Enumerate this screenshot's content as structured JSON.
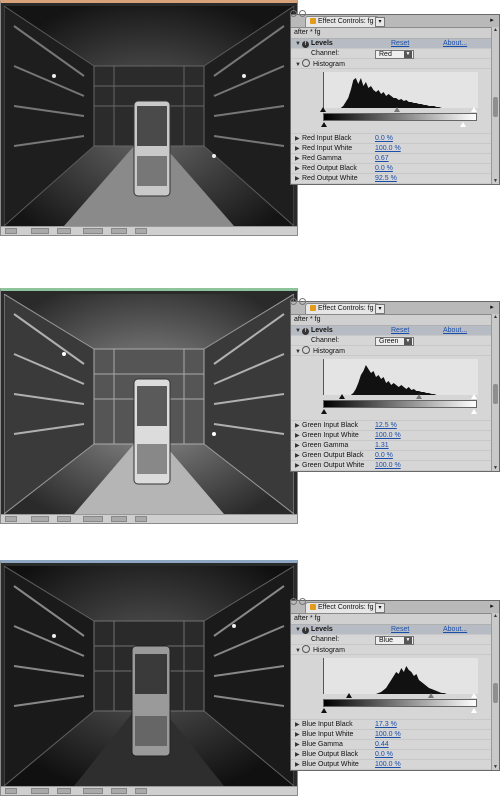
{
  "panels": [
    {
      "tab_title": "Effect Controls: fg",
      "subtitle": "after * fg",
      "effect": {
        "name": "Levels",
        "reset": "Reset",
        "about": "About..."
      },
      "channel": {
        "label": "Channel:",
        "value": "Red"
      },
      "histogram_label": "Histogram",
      "histogram_profile": [
        0,
        0,
        0,
        0,
        0,
        0,
        0,
        0,
        2,
        6,
        10,
        18,
        28,
        30,
        24,
        30,
        22,
        26,
        20,
        22,
        18,
        16,
        18,
        14,
        16,
        12,
        14,
        12,
        10,
        10,
        8,
        9,
        7,
        8,
        6,
        6,
        5,
        5,
        4,
        4,
        3,
        3,
        2,
        2,
        2,
        1,
        1,
        0,
        0,
        0,
        0,
        0,
        0,
        0,
        0,
        0,
        0,
        0,
        0,
        0,
        0,
        0
      ],
      "params": [
        {
          "label": "Red Input Black",
          "value": "0.0 %"
        },
        {
          "label": "Red Input White",
          "value": "100.0 %"
        },
        {
          "label": "Red Gamma",
          "value": "0.67"
        },
        {
          "label": "Red Output Black",
          "value": "0.0 %"
        },
        {
          "label": "Red Output White",
          "value": "92.5 %"
        }
      ]
    },
    {
      "tab_title": "Effect Controls: fg",
      "subtitle": "after * fg",
      "effect": {
        "name": "Levels",
        "reset": "Reset",
        "about": "About..."
      },
      "channel": {
        "label": "Channel:",
        "value": "Green"
      },
      "histogram_label": "Histogram",
      "histogram_profile": [
        0,
        0,
        0,
        0,
        0,
        0,
        0,
        0,
        0,
        0,
        0,
        0,
        2,
        6,
        12,
        20,
        24,
        30,
        26,
        22,
        24,
        18,
        20,
        16,
        18,
        12,
        14,
        10,
        12,
        10,
        8,
        10,
        8,
        6,
        8,
        5,
        6,
        4,
        4,
        3,
        3,
        2,
        2,
        1,
        1,
        0,
        0,
        0,
        0,
        0,
        0,
        0,
        0,
        0,
        0,
        0,
        0,
        0,
        0,
        0,
        0,
        0
      ],
      "params": [
        {
          "label": "Green Input Black",
          "value": "12.5 %"
        },
        {
          "label": "Green Input White",
          "value": "100.0 %"
        },
        {
          "label": "Green Gamma",
          "value": "1.31"
        },
        {
          "label": "Green Output Black",
          "value": "0.0 %"
        },
        {
          "label": "Green Output White",
          "value": "100.0 %"
        }
      ]
    },
    {
      "tab_title": "Effect Controls: fg",
      "subtitle": "after * fg",
      "effect": {
        "name": "Levels",
        "reset": "Reset",
        "about": "About..."
      },
      "channel": {
        "label": "Channel:",
        "value": "Blue"
      },
      "histogram_label": "Histogram",
      "histogram_profile": [
        0,
        0,
        0,
        0,
        0,
        0,
        0,
        0,
        0,
        0,
        0,
        0,
        0,
        0,
        0,
        0,
        0,
        0,
        0,
        0,
        0,
        0,
        1,
        2,
        4,
        6,
        10,
        14,
        18,
        22,
        20,
        26,
        22,
        28,
        24,
        22,
        18,
        20,
        14,
        12,
        10,
        8,
        6,
        5,
        4,
        3,
        2,
        1,
        1,
        0,
        0,
        0,
        0,
        0,
        0,
        0,
        0,
        0,
        0,
        0,
        0,
        0
      ],
      "params": [
        {
          "label": "Blue Input Black",
          "value": "17.3 %"
        },
        {
          "label": "Blue Input White",
          "value": "100.0 %"
        },
        {
          "label": "Blue Gamma",
          "value": "0.44"
        },
        {
          "label": "Blue Output Black",
          "value": "0.0 %"
        },
        {
          "label": "Blue Output White",
          "value": "100.0 %"
        }
      ]
    }
  ],
  "colors": {
    "link": "#1b4ea8",
    "tab_icon": "#e49a1a"
  }
}
